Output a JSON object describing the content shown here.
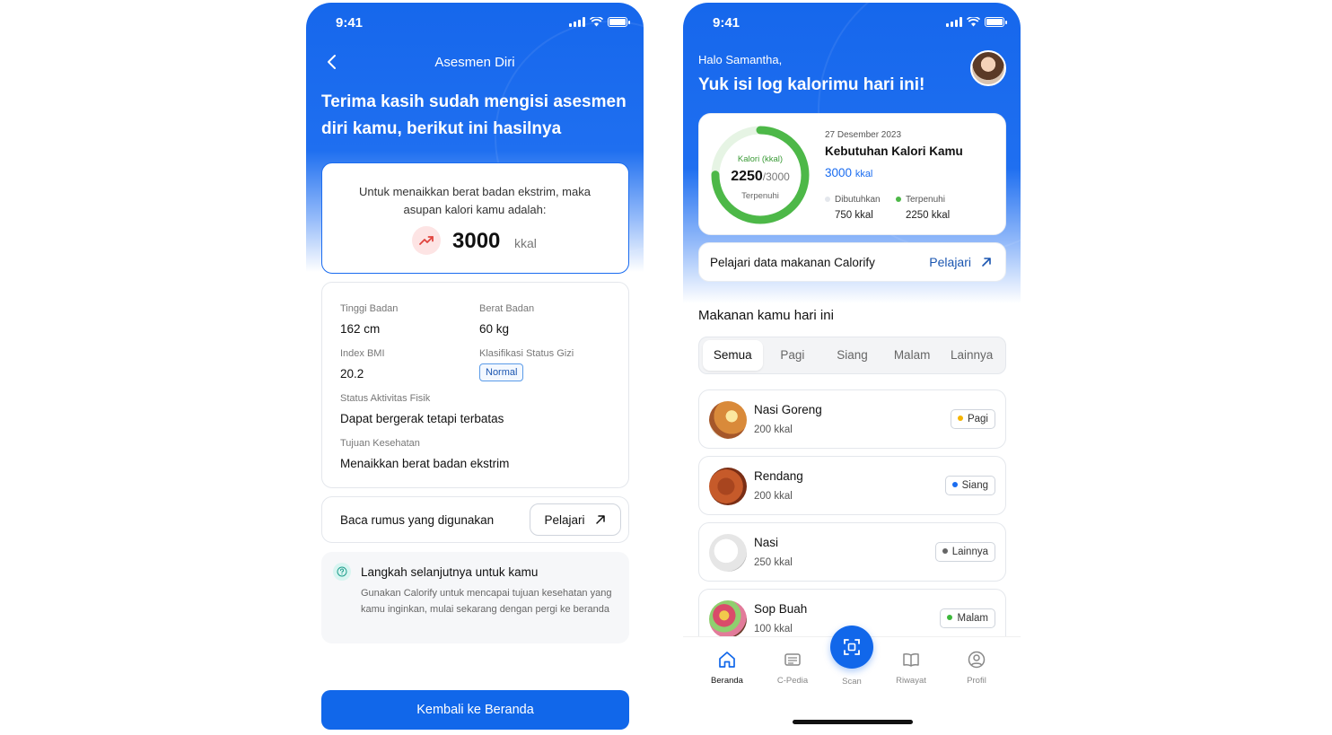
{
  "status_bar": {
    "time": "9:41"
  },
  "assessment": {
    "title": "Asesmen Diri",
    "heading": "Terima kasih sudah mengisi asesmen diri kamu, berikut ini hasilnya",
    "result_desc": "Untuk menaikkan berat badan ekstrim, maka asupan kalori kamu adalah:",
    "result_value": "3000",
    "result_unit": "kkal",
    "fields": {
      "height_label": "Tinggi Badan",
      "height_value": "162 cm",
      "weight_label": "Berat Badan",
      "weight_value": "60 kg",
      "bmi_label": "Index BMI",
      "bmi_value": "20.2",
      "status_label": "Klasifikasi Status Gizi",
      "status_value": "Normal",
      "activity_label": "Status Aktivitas Fisik",
      "activity_value": "Dapat bergerak tetapi terbatas",
      "goal_label": "Tujuan Kesehatan",
      "goal_value": "Menaikkan berat badan ekstrim"
    },
    "formula_text": "Baca rumus yang digunakan",
    "formula_button": "Pelajari",
    "next_title": "Langkah selanjutnya untuk kamu",
    "next_body": "Gunakan Calorify untuk mencapai tujuan kesehatan yang kamu inginkan, mulai sekarang dengan pergi ke beranda",
    "primary_button": "Kembali ke Beranda"
  },
  "home": {
    "greeting": "Halo Samantha,",
    "headline": "Yuk isi log kalorimu hari ini!",
    "calorie": {
      "ring_label": "Kalori (kkal)",
      "consumed": "2250",
      "target_suffix": "/3000",
      "ring_sub": "Terpenuhi",
      "progress": 0.75,
      "date": "27 Desember 2023",
      "title": "Kebutuhan Kalori Kamu",
      "need_value": "3000",
      "need_unit": "kkal",
      "needed_label": "Dibutuhkan",
      "needed_value": "750 kkal",
      "fulfilled_label": "Terpenuhi",
      "fulfilled_value": "2250 kkal"
    },
    "learn": {
      "text": "Pelajari data makanan Calorify",
      "link": "Pelajari"
    },
    "section_title": "Makanan kamu hari ini",
    "tabs": [
      "Semua",
      "Pagi",
      "Siang",
      "Malam",
      "Lainnya"
    ],
    "foods": [
      {
        "name": "Nasi Goreng",
        "kcal": "200 kkal",
        "tag": "Pagi",
        "tag_color": "#f5b400"
      },
      {
        "name": "Rendang",
        "kcal": "200 kkal",
        "tag": "Siang",
        "tag_color": "#1a6cf0"
      },
      {
        "name": "Nasi",
        "kcal": "250 kkal",
        "tag": "Lainnya",
        "tag_color": "#666666"
      },
      {
        "name": "Sop Buah",
        "kcal": "100 kkal",
        "tag": "Malam",
        "tag_color": "#3db83a"
      }
    ],
    "nav": {
      "home": "Beranda",
      "pedia": "C-Pedia",
      "scan": "Scan",
      "history": "Riwayat",
      "profile": "Profil"
    }
  },
  "colors": {
    "primary": "#1167ea",
    "success": "#3db83a",
    "danger": "#e0443e"
  }
}
